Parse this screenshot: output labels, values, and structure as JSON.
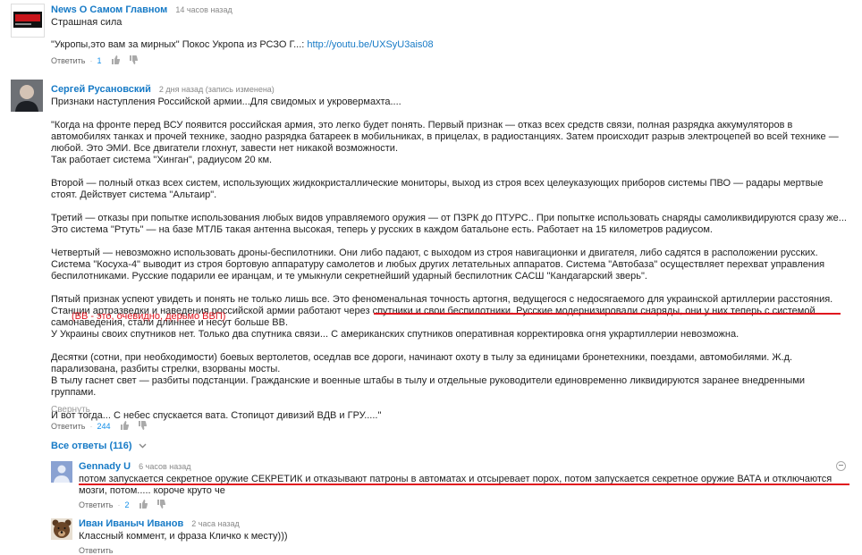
{
  "comments": [
    {
      "author": "News О Самом Главном",
      "time": "14 часов назад",
      "avatar_text": "NEWS",
      "lines": [
        "Страшная сила"
      ],
      "body_prefix": "\"Укропы,это вам за мирных\" Покос Укропа из РСЗО Г...: ",
      "link": "http://youtu.be/UXSyU3ais08",
      "reply_label": "Ответить",
      "likes": "1"
    },
    {
      "author": "Сергей Русановский",
      "time": "2 дня назад (запись изменена)",
      "paragraphs": [
        "Признаки наступления Российской армии...Для свидомых и укровермахта....",
        "",
        "\"Когда на фронте перед ВСУ появится российская армия, это легко будет понять. Первый признак — отказ всех средств связи, полная разрядка аккумуляторов в автомобилях танках и прочей технике, заодно разрядка батареек в мобильниках, в прицелах, в радиостанциях. Затем происходит разрыв электроцепей во всей технике — любой. Это ЭМИ. Все двигатели глохнут, завести нет никакой возможности.",
        "Так работает система \"Хинган\", радиусом 20 км.",
        "",
        "Второй — полный отказ всех систем, использующих жидкокристаллические мониторы, выход из строя всех целеуказующих приборов системы ПВО — радары мертвые стоят. Действует система \"Альтаир\".",
        "",
        "Третий — отказы при попытке использования любых видов управляемого оружия — от ПЗРК до ПТУРС.. При попытке использовать снаряды самоликвидируются сразу же... Это система \"Ртуть\" — на базе МТЛБ такая антенна высокая, теперь у русских в каждом батальоне есть. Работает на 15 километров радиусом.",
        "",
        "Четвертый — невозможно использовать дроны-беспилотники. Они либо падают, с выходом из строя навигационки и двигателя, либо садятся в расположении русских. Система \"Косуха-4\" выводит из строя бортовую аппаратуру самолетов и любых других летательных аппаратов. Система \"Автобаза\" осуществляет перехват управления беспилотниками. Русские подарили ее иранцам, и те умыкнули секретнейший ударный беспилотник САСШ \"Кандагарский зверь\".",
        "",
        "Пятый признак успеют увидеть и понять не только лишь все. Это феноменальная точность артогня, ведущегося с недосягаемого для украинской артиллерии расстояния. Станции артразведки и наведения российской армии работают через спутники и свои беспилотники. Русские модернизировали снаряды, они у них теперь с системой самонаведения, стали длиннее и несут больше ВВ.",
        "У Украины своих спутников нет. Только два спутника связи... С американских спутников оперативная корректировка огня украртиллерии невозможна.",
        "",
        "Десятки (сотни, при необходимости) боевых вертолетов, оседлав все дороги, начинают охоту в тылу за единицами бронетехники, поездами, автомобилями. Ж.д. парализована, разбиты стрелки, взорваны мосты.",
        "В тылу гаснет свет — разбиты подстанции. Гражданские и военные штабы в тылу и отдельные руководители единовременно ликвидируются заранее внедренными группами.",
        "",
        "И вот тогда... С небес спускается вата. Стопицот дивизий ВДВ и ГРУ.....\""
      ],
      "annotation": "(ВВ - это, очевидно, дерьмо ВВП)",
      "collapse_label": "Свернуть",
      "reply_label": "Ответить",
      "likes": "244",
      "all_replies_label": "Все ответы (116)"
    }
  ],
  "replies": [
    {
      "author": "Gennady U",
      "time": "6 часов назад",
      "text": "потом запускается секретное оружие СЕКРЕТИК и отказывают патроны в автоматах и отсыревает порох, потом запускается секретное оружие ВАТА и отключаются мозги, потом..... короче круто че",
      "reply_label": "Ответить",
      "likes": "2"
    },
    {
      "author": "Иван Иваныч Иванов",
      "time": "2 часа назад",
      "text": "Классный коммент, и фраза Кличко к месту)))",
      "reply_label": "Ответить"
    }
  ],
  "colors": {
    "accent": "#167ac6",
    "annotation": "#e0141e",
    "likes": "#128ee9"
  }
}
